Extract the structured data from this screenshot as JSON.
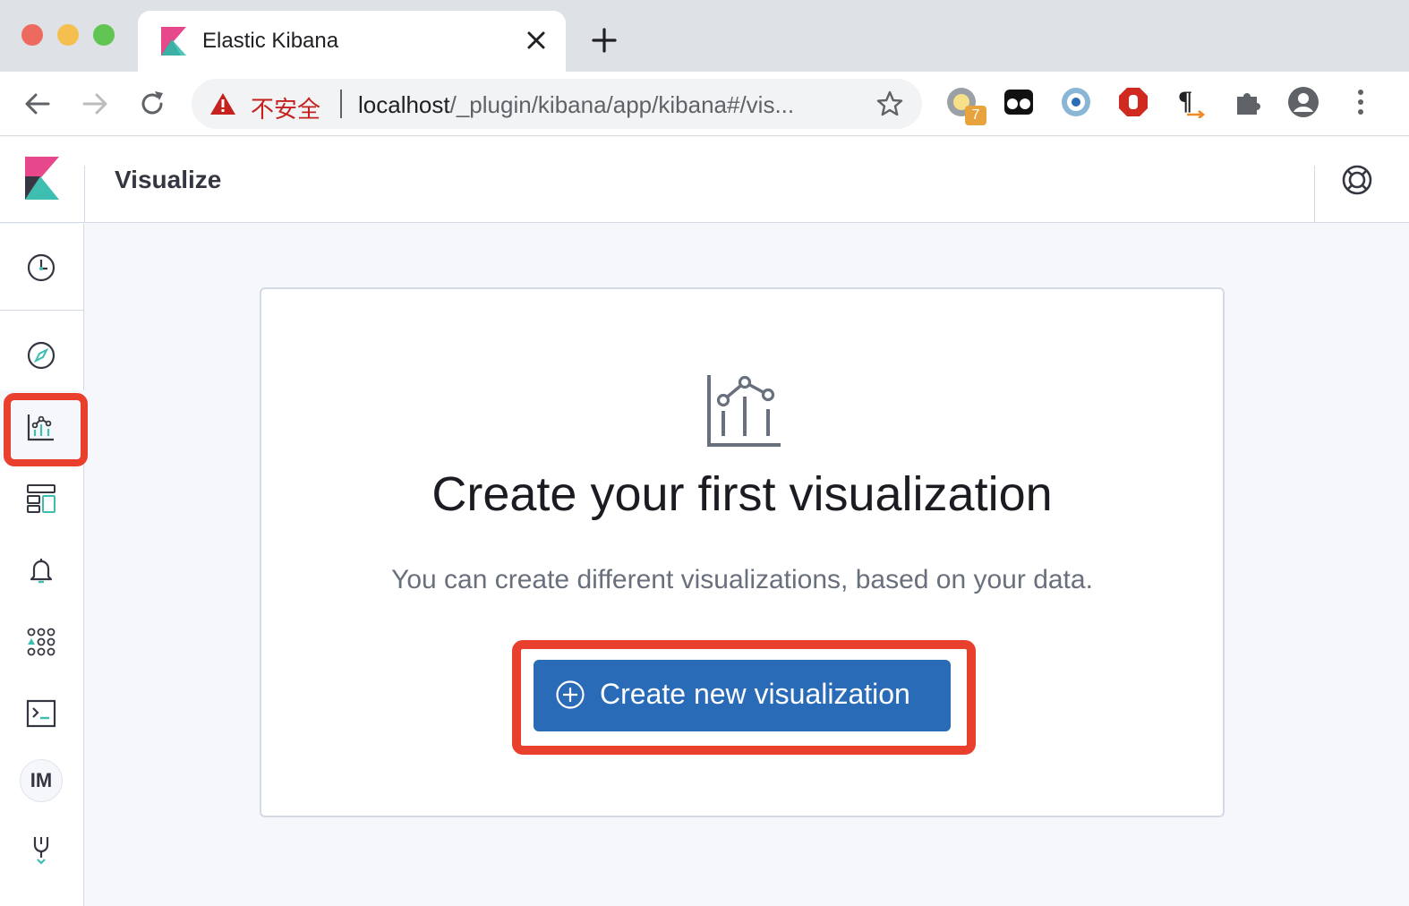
{
  "browser": {
    "tab_title": "Elastic Kibana",
    "security_label": "不安全",
    "url_host": "localhost",
    "url_path": "/_plugin/kibana/app/kibana#/vis...",
    "extension_badge": "7"
  },
  "header": {
    "title": "Visualize"
  },
  "sidenav": {
    "items": [
      {
        "name": "recently-viewed",
        "icon": "clock-icon"
      },
      {
        "name": "discover",
        "icon": "compass-icon"
      },
      {
        "name": "visualize",
        "icon": "visualize-icon",
        "active": true
      },
      {
        "name": "dashboard",
        "icon": "dashboard-icon"
      },
      {
        "name": "alerting",
        "icon": "bell-icon"
      },
      {
        "name": "anomaly-detection",
        "icon": "dots-grid-icon"
      },
      {
        "name": "query-workbench",
        "icon": "console-icon"
      },
      {
        "name": "index-management",
        "label": "IM"
      },
      {
        "name": "dev-tools",
        "icon": "wrench-icon"
      }
    ]
  },
  "empty_state": {
    "title": "Create your first visualization",
    "body": "You can create different visualizations, based on your data.",
    "cta_label": "Create new visualization"
  },
  "colors": {
    "primary": "#2a6bb7",
    "highlight": "#e8402c",
    "tab_strip": "#dee1e6"
  }
}
